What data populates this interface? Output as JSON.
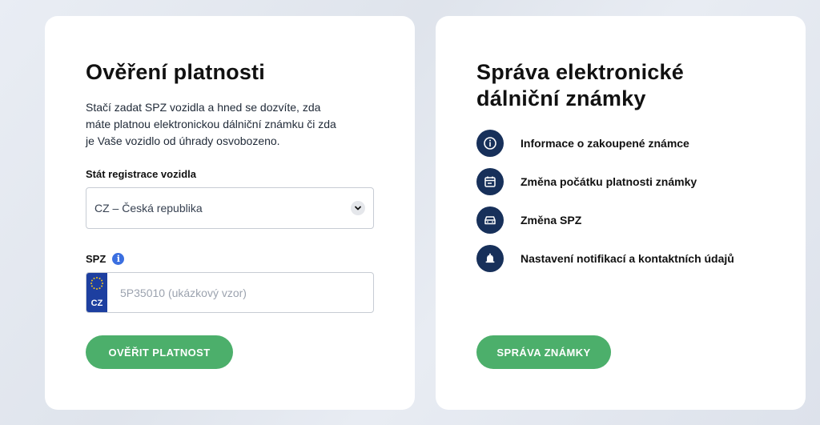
{
  "colors": {
    "accent_green": "#4caf6b",
    "icon_navy": "#17305a",
    "eu_blue": "#1d3fa0",
    "info_blue": "#3b6fe0"
  },
  "verify": {
    "title": "Ověření platnosti",
    "description": "Stačí zadat SPZ vozidla a hned se dozvíte, zda máte platnou elektronickou dálniční známku či zda je Vaše vozidlo od úhrady osvobozeno.",
    "state_label": "Stát registrace vozidla",
    "state_value": "CZ – Česká republika",
    "spz_label": "SPZ",
    "spz_info_icon": "info-icon",
    "plate_country": "CZ",
    "spz_placeholder": "5P35010 (ukázkový vzor)",
    "button_label": "OVĚŘIT PLATNOST"
  },
  "manage": {
    "title": "Správa elektronické dálniční známky",
    "items": [
      {
        "icon": "info-icon",
        "label": "Informace o zakoupené známce"
      },
      {
        "icon": "calendar-icon",
        "label": "Změna počátku platnosti známky"
      },
      {
        "icon": "car-icon",
        "label": "Změna SPZ"
      },
      {
        "icon": "bell-icon",
        "label": "Nastavení notifikací a kontaktních údajů"
      }
    ],
    "button_label": "SPRÁVA ZNÁMKY"
  }
}
